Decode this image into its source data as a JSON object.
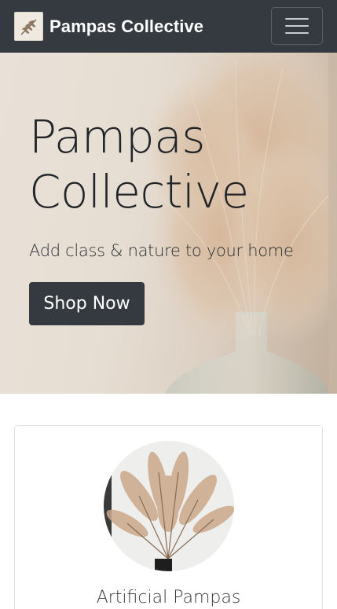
{
  "navbar": {
    "brand_name": "Pampas Collective",
    "logo_icon": "pampas-leaf-icon",
    "toggle_icon": "hamburger-menu-icon",
    "background": "#343a40"
  },
  "hero": {
    "title": "Pampas Collective",
    "subtitle": "Add class & nature to your home",
    "cta_label": "Shop Now",
    "image": "pampas-grass-in-glass-vase"
  },
  "product_card": {
    "title": "Artificial Pampas",
    "image": "artificial-pampas-bouquet"
  }
}
